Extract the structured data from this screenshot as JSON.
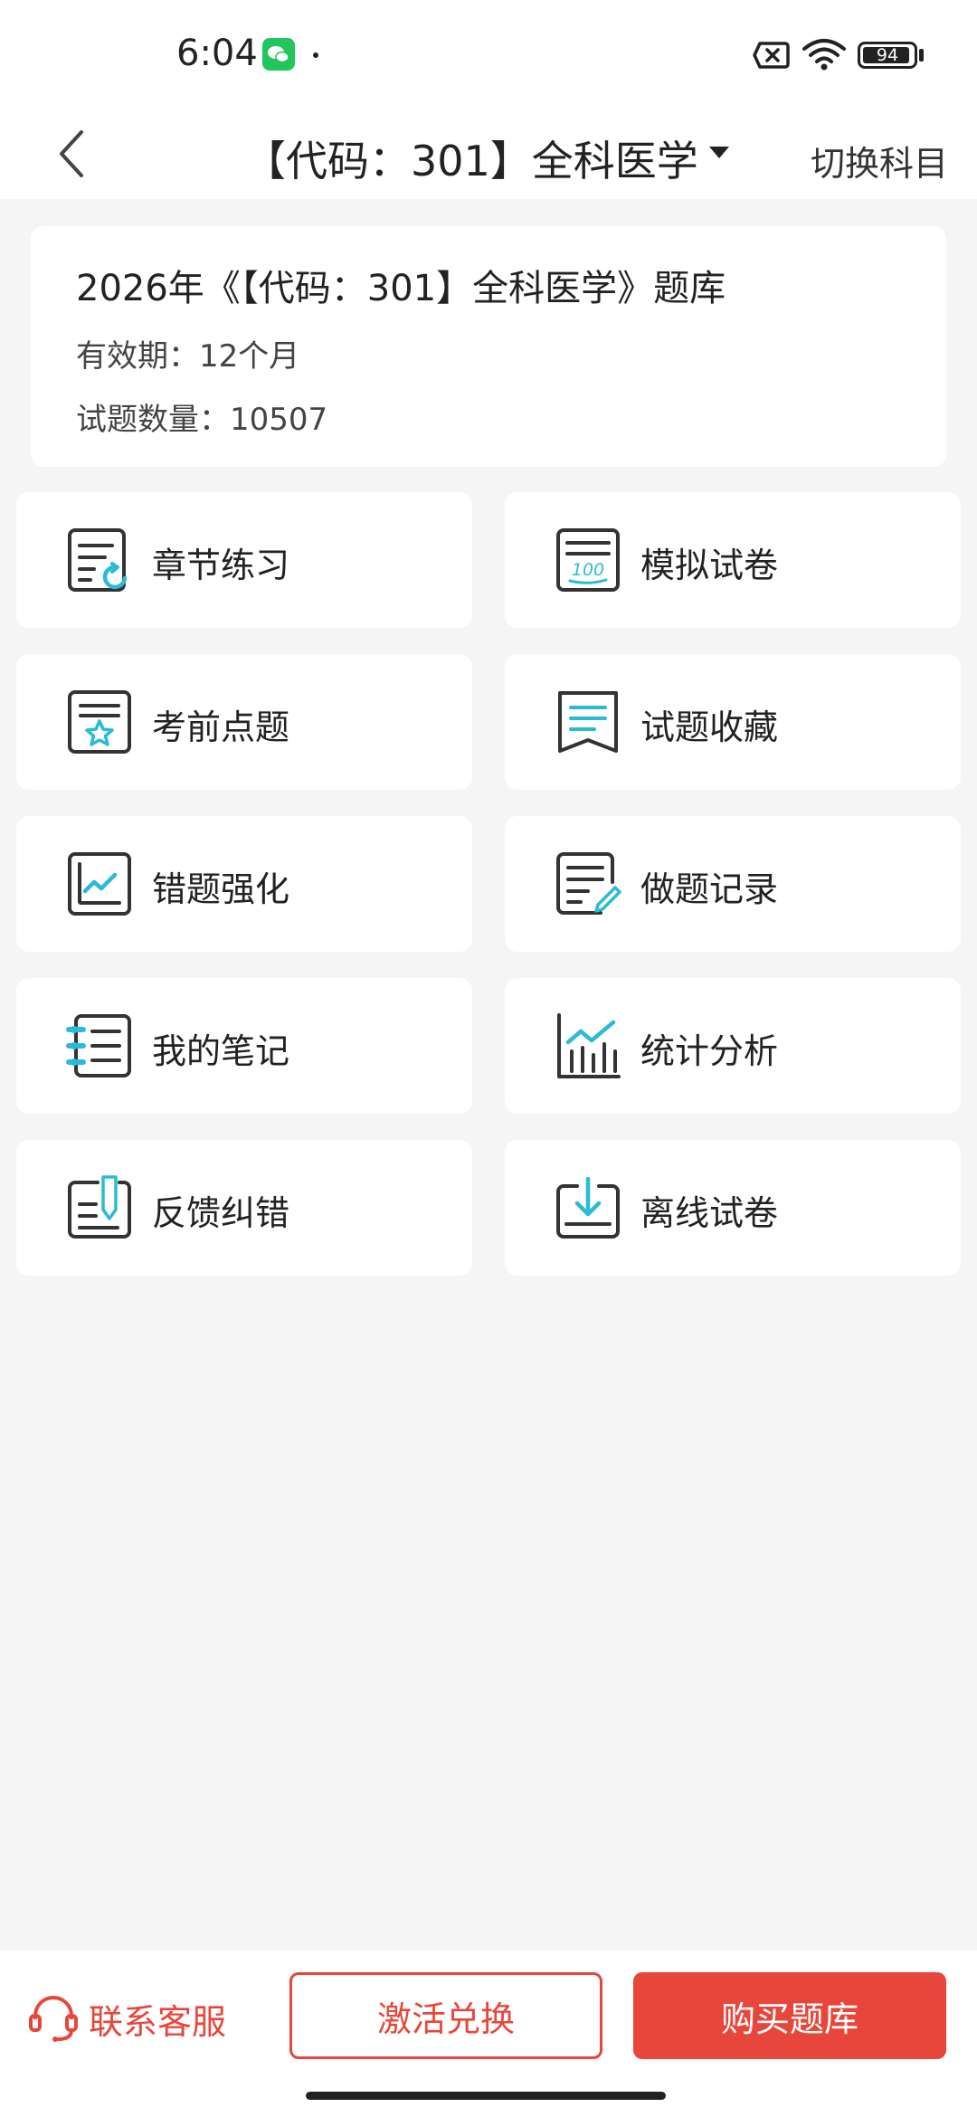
{
  "status_bar": {
    "time": "6:04",
    "battery": "94",
    "battery_level_pct": 94
  },
  "nav": {
    "title": "【代码：301】全科医学",
    "switch_label": "切换科目"
  },
  "info": {
    "title": "2026年《【代码：301】全科医学》题库",
    "validity": "有效期：12个月",
    "count": "试题数量：10507"
  },
  "menu": [
    {
      "label": "章节练习",
      "icon": "chapter-practice-icon"
    },
    {
      "label": "模拟试卷",
      "icon": "mock-exam-icon"
    },
    {
      "label": "考前点题",
      "icon": "pre-exam-star-icon"
    },
    {
      "label": "试题收藏",
      "icon": "bookmark-icon"
    },
    {
      "label": "错题强化",
      "icon": "trend-chart-icon"
    },
    {
      "label": "做题记录",
      "icon": "edit-record-icon"
    },
    {
      "label": "我的笔记",
      "icon": "notebook-icon"
    },
    {
      "label": "统计分析",
      "icon": "bar-chart-icon"
    },
    {
      "label": "反馈纠错",
      "icon": "feedback-pen-icon"
    },
    {
      "label": "离线试卷",
      "icon": "download-icon"
    }
  ],
  "bottom": {
    "contact": "联系客服",
    "activate": "激活兑换",
    "buy": "购买题库"
  },
  "colors": {
    "accent": "#e8463a",
    "icon_teal": "#2bbbd6",
    "icon_dark": "#333333"
  }
}
